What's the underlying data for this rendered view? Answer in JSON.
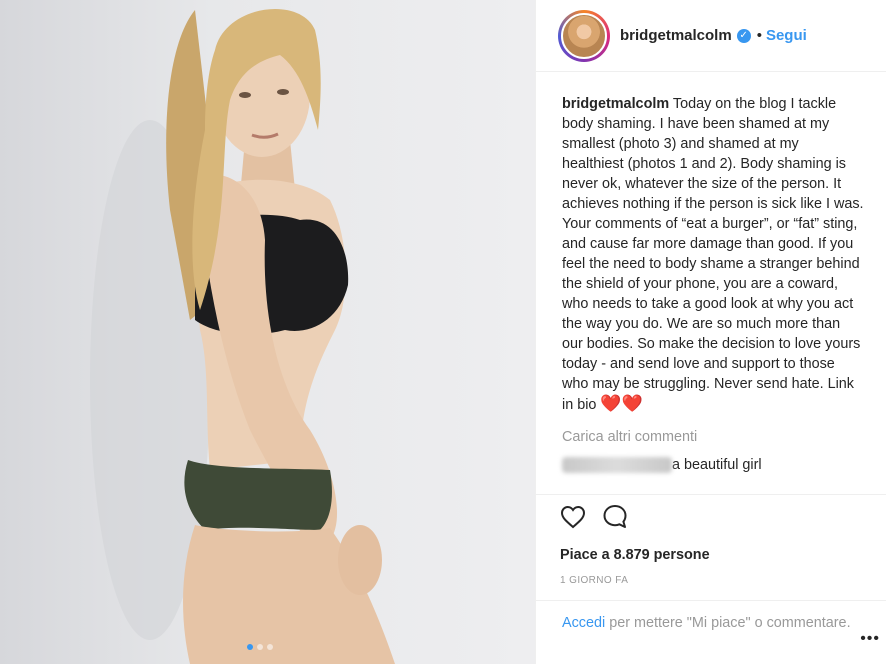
{
  "header": {
    "username": "bridgetmalcolm",
    "verified_glyph": "✓",
    "separator": "•",
    "follow_label": "Segui"
  },
  "caption": {
    "username": "bridgetmalcolm",
    "text": "Today on the blog I tackle body shaming. I have been shamed at my smallest (photo 3) and shamed at my healthiest (photos 1 and 2). Body shaming is never ok, whatever the size of the person. It achieves nothing if the person is sick like I was. Your comments of “eat a burger”, or “fat” sting, and cause far more damage than good. If you feel the need to body shame a stranger behind the shield of your phone, you are a coward, who needs to take a good look at why you act the way you do. We are so much more than our bodies. So make the decision to love yours today - and send love and support to those who may be struggling. Never send hate. Link in bio",
    "hearts": "❤️❤️"
  },
  "load_more_label": "Carica altri commenti",
  "comment": {
    "text": "a beautiful girl"
  },
  "actions": {
    "like_icon": "heart-outline-icon",
    "comment_icon": "speech-bubble-icon"
  },
  "likes_label": "Piace a 8.879 persone",
  "time_label": "1 GIORNO FA",
  "login": {
    "link_label": "Accedi",
    "rest_text": "per mettere \"Mi piace\" o commentare."
  },
  "more_label": "•••",
  "carousel": {
    "total": 3,
    "active_index": 0
  },
  "colors": {
    "accent": "#3897f0",
    "text": "#262626",
    "muted": "#999999",
    "heart": "#e0131f"
  }
}
